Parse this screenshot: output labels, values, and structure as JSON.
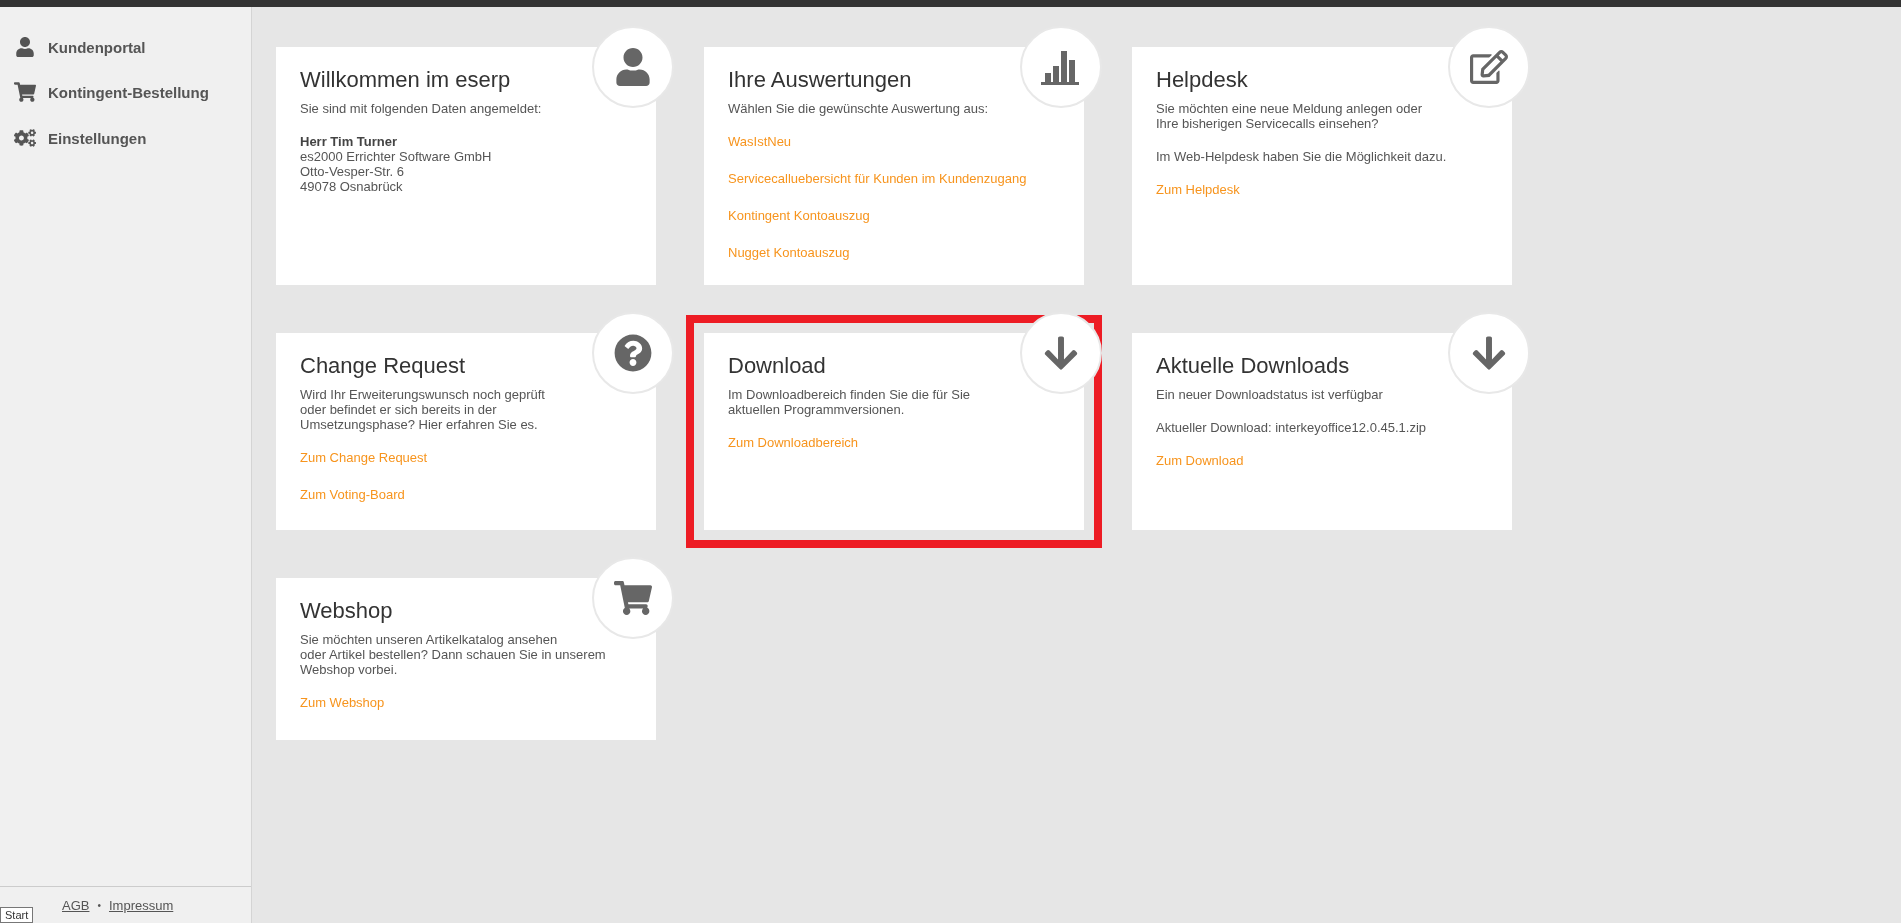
{
  "sidebar": {
    "items": [
      {
        "label": "Kundenportal",
        "kind": "person"
      },
      {
        "label": "Kontingent-Bestellung",
        "kind": "cart"
      },
      {
        "label": "Einstellungen",
        "kind": "gears"
      }
    ],
    "footer": {
      "links": [
        "AGB",
        "Impressum"
      ],
      "separator": "•"
    },
    "tooltip": "Start"
  },
  "cards": [
    {
      "title": "Willkommen im eserp",
      "kind": "person",
      "highlighted": false,
      "blocks": [
        {
          "kind": "text",
          "text": "Sie sind mit folgenden Daten angemeldet:"
        },
        {
          "kind": "address",
          "name": "Herr Tim Turner",
          "lines": [
            "es2000 Errichter Software GmbH",
            "Otto-Vesper-Str. 6",
            "49078 Osnabrück"
          ]
        }
      ]
    },
    {
      "title": "Ihre Auswertungen",
      "kind": "chart",
      "highlighted": false,
      "blocks": [
        {
          "kind": "text",
          "text": "Wählen Sie die gewünschte Auswertung aus:"
        },
        {
          "kind": "link",
          "text": "WasIstNeu"
        },
        {
          "kind": "link",
          "text": "Servicecalluebersicht für Kunden im Kundenzugang"
        },
        {
          "kind": "link",
          "text": "Kontingent Kontoauszug"
        },
        {
          "kind": "link",
          "text": "Nugget Kontoauszug"
        }
      ]
    },
    {
      "title": "Helpdesk",
      "kind": "edit",
      "highlighted": false,
      "blocks": [
        {
          "kind": "text",
          "text": "Sie möchten eine neue Meldung anlegen oder\nIhre bisherigen Servicecalls einsehen?"
        },
        {
          "kind": "text",
          "text": "Im Web-Helpdesk haben Sie die Möglichkeit dazu."
        },
        {
          "kind": "link",
          "text": "Zum Helpdesk"
        }
      ]
    },
    {
      "title": "Change Request",
      "kind": "question",
      "highlighted": false,
      "blocks": [
        {
          "kind": "text",
          "text": "Wird Ihr Erweiterungswunsch noch geprüft\noder befindet er sich bereits in der\nUmsetzungsphase? Hier erfahren Sie es."
        },
        {
          "kind": "link",
          "text": "Zum Change Request"
        },
        {
          "kind": "link",
          "text": "Zum Voting-Board"
        }
      ]
    },
    {
      "title": "Download",
      "kind": "download",
      "highlighted": true,
      "blocks": [
        {
          "kind": "text",
          "text": "Im Downloadbereich finden Sie die für Sie\naktuellen Programmversionen."
        },
        {
          "kind": "link",
          "text": "Zum Downloadbereich"
        }
      ]
    },
    {
      "title": "Aktuelle Downloads",
      "kind": "download",
      "highlighted": false,
      "blocks": [
        {
          "kind": "text",
          "text": "Ein neuer Downloadstatus ist verfügbar"
        },
        {
          "kind": "text",
          "text": "Aktueller Download: interkeyoffice12.0.45.1.zip"
        },
        {
          "kind": "link",
          "text": "Zum Download"
        }
      ]
    },
    {
      "title": "Webshop",
      "kind": "cart",
      "highlighted": false,
      "blocks": [
        {
          "kind": "text",
          "text": "Sie möchten unseren Artikelkatalog ansehen\noder Artikel bestellen? Dann schauen Sie in unserem\nWebshop vorbei."
        },
        {
          "kind": "link",
          "text": "Zum Webshop"
        }
      ]
    }
  ]
}
